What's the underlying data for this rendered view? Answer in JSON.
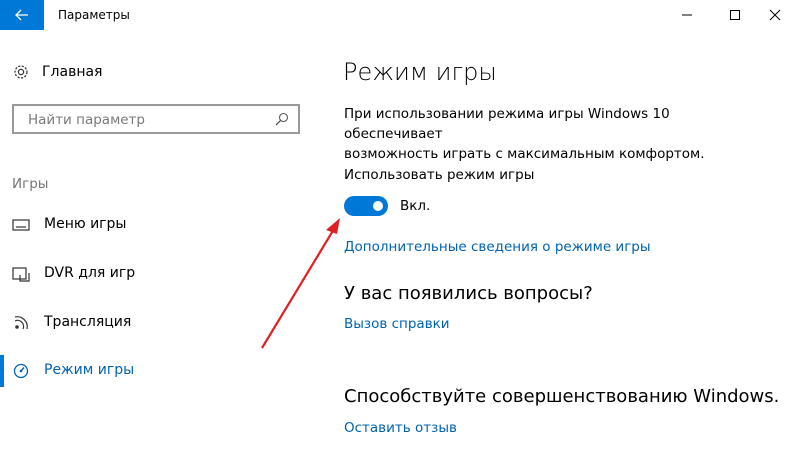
{
  "window": {
    "title": "Параметры"
  },
  "sidebar": {
    "home_label": "Главная",
    "search_placeholder": "Найти параметр",
    "group_label": "Игры",
    "items": [
      {
        "label": "Меню игры",
        "icon": "game-bar-icon"
      },
      {
        "label": "DVR для игр",
        "icon": "game-dvr-icon"
      },
      {
        "label": "Трансляция",
        "icon": "broadcasting-icon"
      },
      {
        "label": "Режим игры",
        "icon": "game-mode-icon",
        "selected": true
      }
    ]
  },
  "main": {
    "title": "Режим игры",
    "description_line1": "При использовании режима игры Windows 10 обеспечивает",
    "description_line2": "возможность играть с максимальным комфортом.",
    "toggle_label": "Использовать режим игры",
    "toggle_state": "Вкл.",
    "toggle_on": true,
    "more_info_link": "Дополнительные сведения о режиме игры",
    "questions_heading": "У вас появились вопросы?",
    "help_link": "Вызов справки",
    "improve_heading": "Способствуйте совершенствованию Windows.",
    "feedback_link": "Оставить отзыв"
  },
  "colors": {
    "accent": "#0078d7",
    "link": "#0063b1",
    "annotation_arrow": "#e02020"
  }
}
